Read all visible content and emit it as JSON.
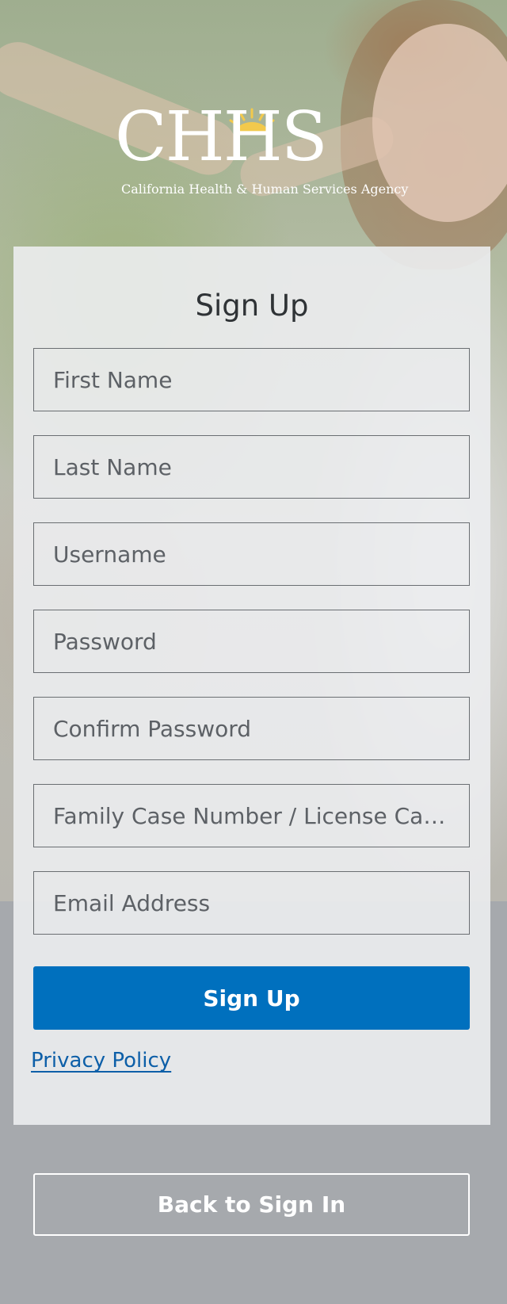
{
  "logo": {
    "letters": "CHHS",
    "tagline": "California Health & Human Services Agency"
  },
  "signup": {
    "title": "Sign Up",
    "fields": {
      "first_name": {
        "placeholder": "First Name",
        "value": ""
      },
      "last_name": {
        "placeholder": "Last Name",
        "value": ""
      },
      "username": {
        "placeholder": "Username",
        "value": ""
      },
      "password": {
        "placeholder": "Password",
        "value": ""
      },
      "confirm_password": {
        "placeholder": "Confirm Password",
        "value": ""
      },
      "case_number": {
        "placeholder": "Family Case Number / License Case Number",
        "value": ""
      },
      "email": {
        "placeholder": "Email Address",
        "value": ""
      }
    },
    "submit_label": "Sign Up",
    "privacy_link": "Privacy Policy"
  },
  "footer": {
    "back_label": "Back to Sign In"
  },
  "colors": {
    "primary_button": "#0070be",
    "link": "#0d5fa8",
    "sun_accent": "#f2c94c"
  }
}
